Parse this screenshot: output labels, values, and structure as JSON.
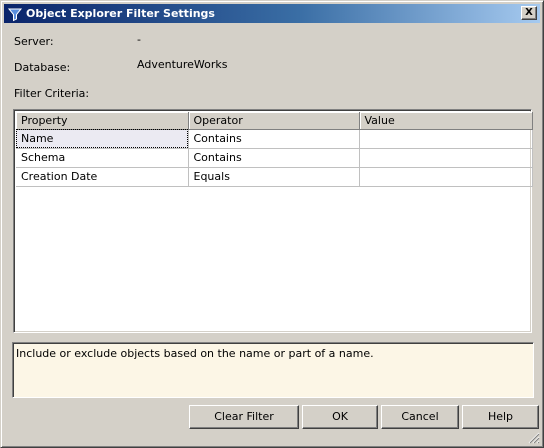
{
  "window": {
    "title": "Object Explorer Filter Settings",
    "close_label": "X"
  },
  "labels": {
    "server": "Server:",
    "server_value": "-",
    "database": "Database:",
    "database_value": "AdventureWorks",
    "filter_criteria": "Filter Criteria:"
  },
  "grid": {
    "columns": [
      "Property",
      "Operator",
      "Value"
    ],
    "rows": [
      {
        "property": "Name",
        "operator": "Contains",
        "value": ""
      },
      {
        "property": "Schema",
        "operator": "Contains",
        "value": ""
      },
      {
        "property": "Creation Date",
        "operator": "Equals",
        "value": ""
      }
    ],
    "selected_row": 0
  },
  "description": "Include or exclude objects based on the name or part of a name.",
  "buttons": {
    "clear_filter": "Clear Filter",
    "ok": "OK",
    "cancel": "Cancel",
    "help": "Help"
  },
  "icons": {
    "title": "funnel-icon",
    "close": "close-icon",
    "resize": "resize-grip-icon"
  },
  "colors": {
    "title_start": "#0a246a",
    "title_end": "#a6caf0",
    "description_bg": "#fcf6e6",
    "dialog_bg": "#d4d0c8"
  }
}
